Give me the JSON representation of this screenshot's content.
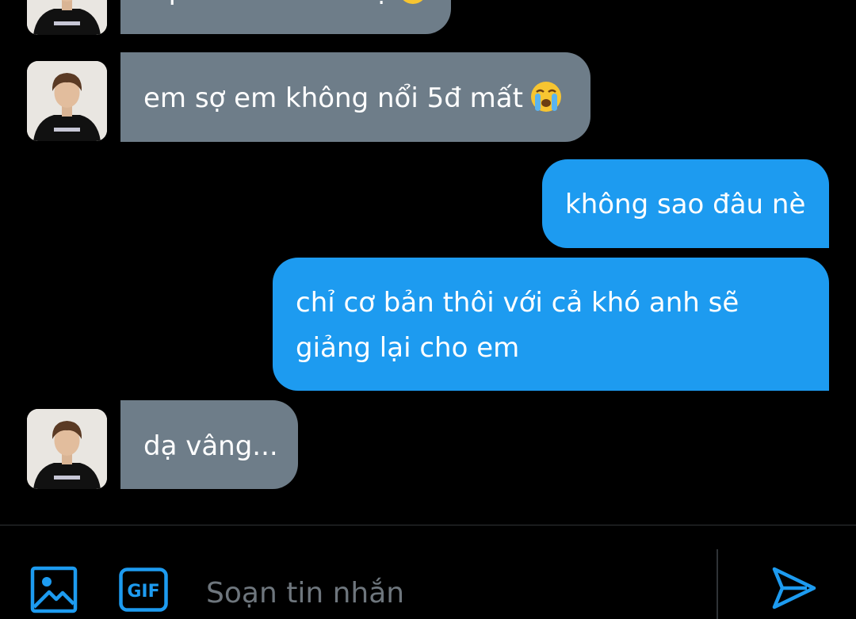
{
  "conversation": {
    "messages": [
      {
        "direction": "incoming",
        "text": "ô phải test trước ạ",
        "emoji": "smiling-face-emoji",
        "has_avatar": true
      },
      {
        "direction": "incoming",
        "text": "em sợ em không nổi 5đ mất",
        "emoji": "loudly-crying-face-emoji",
        "has_avatar": true
      },
      {
        "direction": "outgoing",
        "text": "không sao đâu nè"
      },
      {
        "direction": "outgoing",
        "lines": [
          "chỉ cơ bản thôi với cả khó anh sẽ",
          "giảng lại cho em"
        ]
      },
      {
        "direction": "incoming",
        "text": "dạ vâng...",
        "has_avatar": true
      }
    ]
  },
  "composer": {
    "placeholder": "Soạn tin nhắn",
    "media_icon": "image-icon",
    "gif_icon": "gif-icon",
    "gif_label": "GIF",
    "send_icon": "send-icon"
  },
  "colors": {
    "background": "#000000",
    "incoming_bubble": "#6e7d89",
    "outgoing_bubble": "#1d9bf0",
    "accent": "#1d9bf0",
    "placeholder": "#6e767d",
    "divider": "#2f3336"
  }
}
